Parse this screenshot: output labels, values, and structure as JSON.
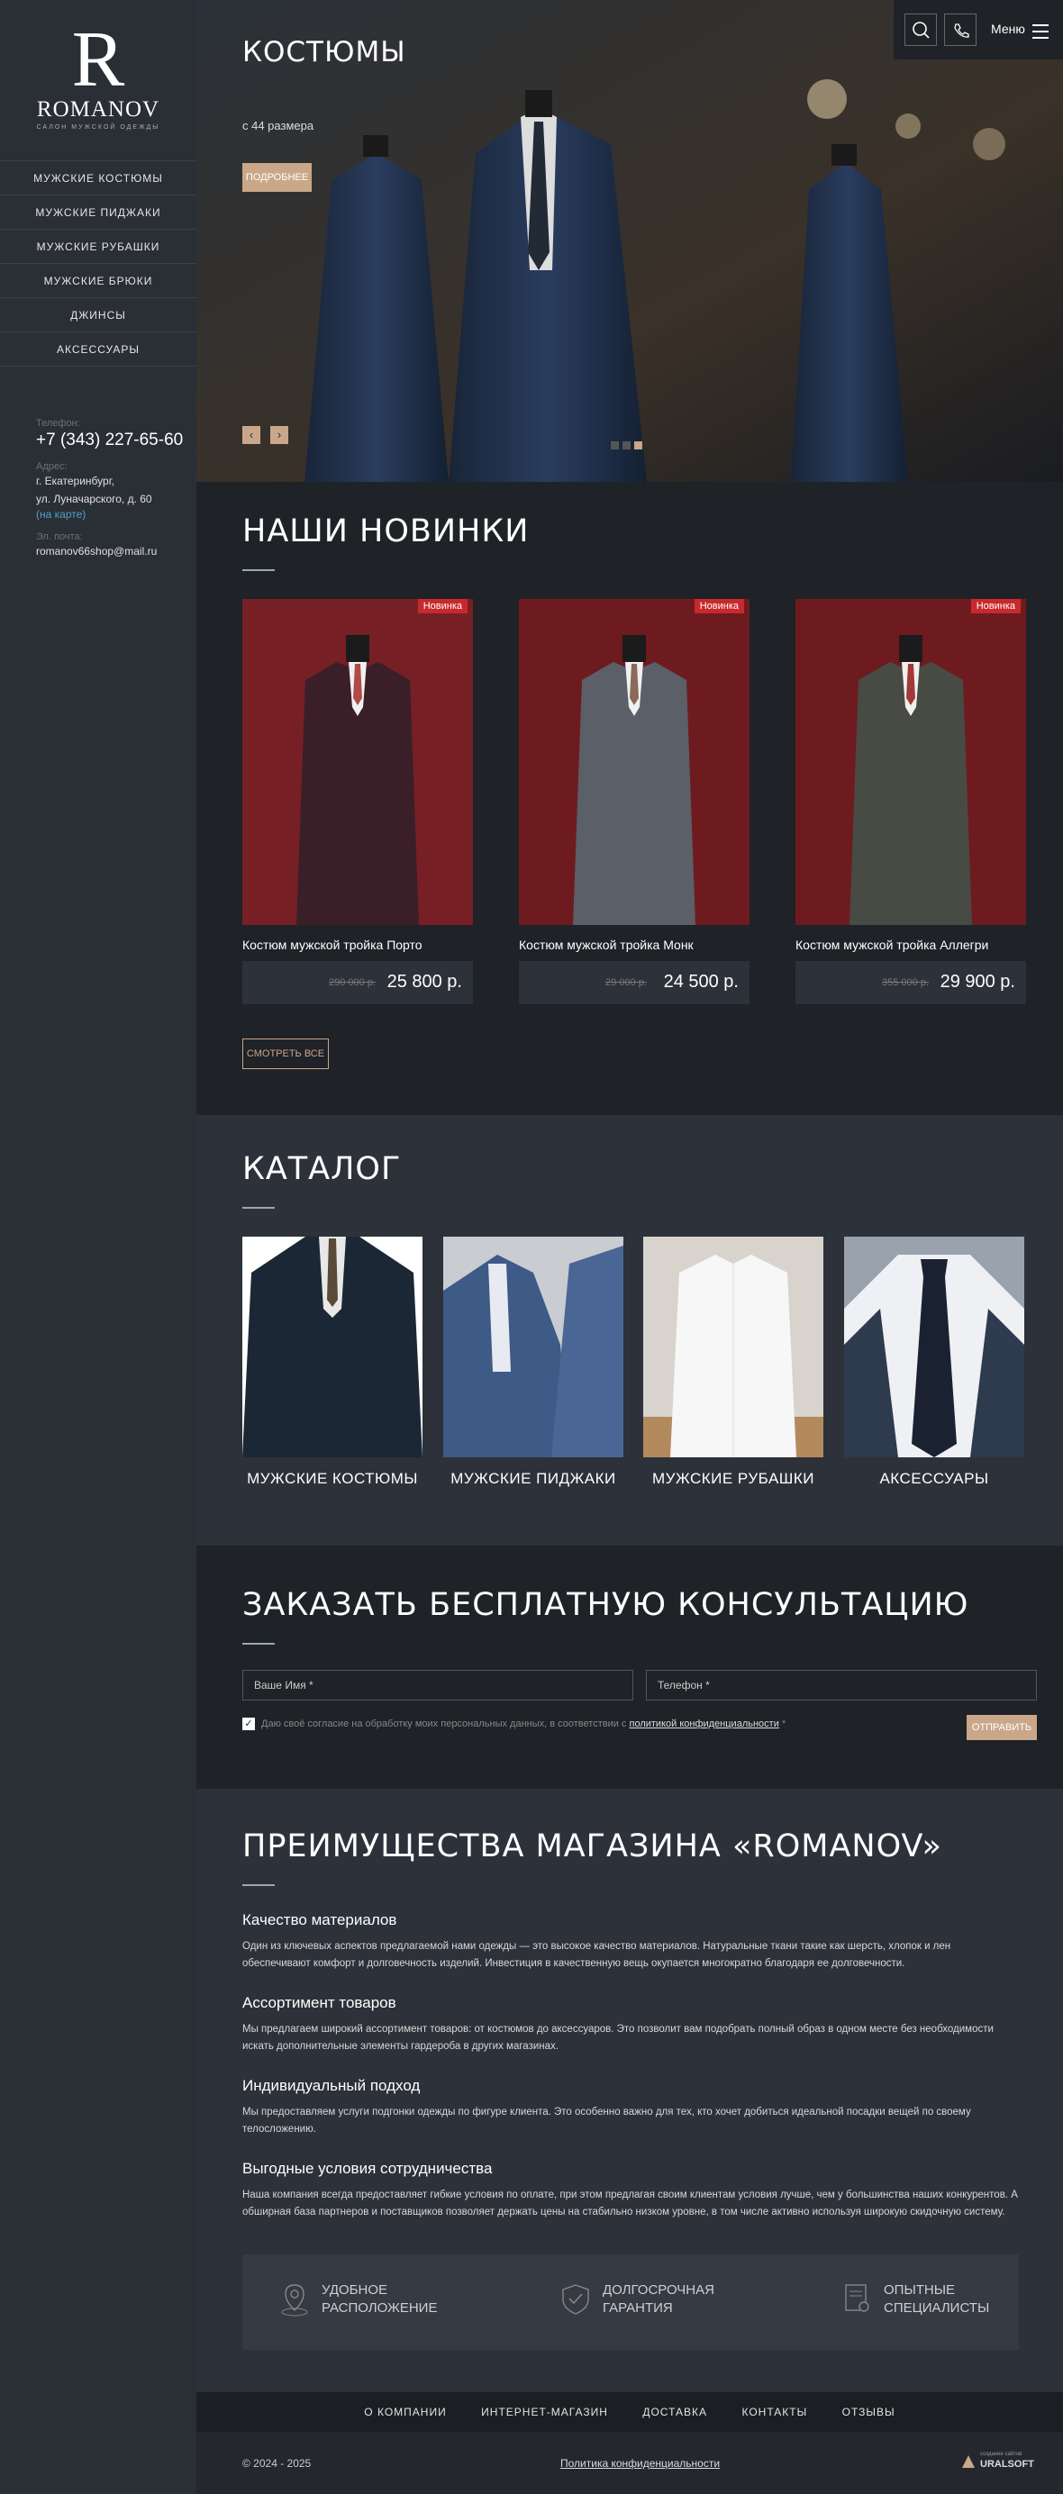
{
  "brand": {
    "letter": "R",
    "name": "ROMANOV",
    "tagline": "САЛОН МУЖСКОЙ ОДЕЖДЫ"
  },
  "sidebar": {
    "items": [
      {
        "label": "МУЖСКИЕ КОСТЮМЫ"
      },
      {
        "label": "МУЖСКИЕ ПИДЖАКИ"
      },
      {
        "label": "МУЖСКИЕ РУБАШКИ"
      },
      {
        "label": "МУЖСКИЕ БРЮКИ"
      },
      {
        "label": "ДЖИНСЫ"
      },
      {
        "label": "АКСЕССУАРЫ"
      }
    ],
    "phone_label": "Телефон:",
    "phone": "+7 (343) 227-65-60",
    "address_label": "Адрес:",
    "address1": "г. Екатеринбург,",
    "address2": "ул. Луначарского, д. 60",
    "map_link": "(на карте)",
    "email_label": "Эл. почта:",
    "email": "romanov66shop@mail.ru"
  },
  "header": {
    "menu_label": "Меню",
    "icons": [
      "search-icon",
      "phone-icon",
      "hamburger-icon"
    ]
  },
  "hero": {
    "title": "КОСТЮМЫ",
    "subtitle": "с 44 размера",
    "button": "ПОДРОБНЕЕ",
    "prev": "‹",
    "next": "›",
    "slide_count": 3,
    "active_slide": 3
  },
  "novelties": {
    "title": "НАШИ НОВИНКИ",
    "badge": "Новинка",
    "button": "СМОТРЕТЬ ВСЕ",
    "products": [
      {
        "name": "Костюм мужской тройка Порто",
        "old_price": "290 000 р.",
        "price": "25 800 р."
      },
      {
        "name": "Костюм мужской тройка Монк",
        "old_price": "29 000 р.",
        "price": "24 500 р."
      },
      {
        "name": "Костюм мужской тройка Аллегри",
        "old_price": "355 000 р.",
        "price": "29 900 р."
      }
    ]
  },
  "catalog": {
    "title": "КАТАЛОГ",
    "items": [
      {
        "label": "МУЖСКИЕ КОСТЮМЫ"
      },
      {
        "label": "МУЖСКИЕ ПИДЖАКИ"
      },
      {
        "label": "МУЖСКИЕ РУБАШКИ"
      },
      {
        "label": "АКСЕССУАРЫ"
      }
    ]
  },
  "consult": {
    "title": "ЗАКАЗАТЬ БЕСПЛАТНУЮ КОНСУЛЬТАЦИЮ",
    "name_placeholder": "Ваше Имя *",
    "phone_placeholder": "Телефон *",
    "agree_text": "Даю своё согласие на обработку моих персональных данных, в соответствии с ",
    "agree_link": "политикой конфиденциальности",
    "agree_star": " *",
    "submit": "ОТПРАВИТЬ"
  },
  "advantages": {
    "title": "ПРЕИМУЩЕСТВА МАГАЗИНА «ROMANOV»",
    "blocks": [
      {
        "h": "Качество материалов",
        "p": "Один из ключевых аспектов предлагаемой нами одежды — это высокое качество материалов. Натуральные ткани такие как шерсть, хлопок и лен обеспечивают комфорт и долговечность изделий. Инвестиция в качественную вещь окупается многократно благодаря ее долговечности."
      },
      {
        "h": "Ассортимент товаров",
        "p": "Мы предлагаем широкий ассортимент товаров: от костюмов до аксессуаров. Это позволит вам подобрать полный образ в одном месте без необходимости искать дополнительные элементы гардероба в других магазинах."
      },
      {
        "h": "Индивидуальный подход",
        "p": "Мы предоставляем услуги  подгонки одежды по фигуре клиента. Это особенно важно для тех, кто хочет добиться идеальной посадки вещей по своему телосложению."
      },
      {
        "h": "Выгодные условия сотрудничества",
        "p": "Наша компания всегда предоставляет гибкие условия по оплате, при этом предлагая своим клиентам условия лучше, чем у большинства наших конкурентов. А обширная база партнеров и поставщиков позволяет держать цены на стабильно низком уровне, в том числе активно используя широкую скидочную систему."
      }
    ],
    "features": [
      {
        "l1": "УДОБНОЕ",
        "l2": "РАСПОЛОЖЕНИЕ",
        "icon": "location-icon"
      },
      {
        "l1": "ДОЛГОСРОЧНАЯ",
        "l2": "ГАРАНТИЯ",
        "icon": "shield-icon"
      },
      {
        "l1": "ОПЫТНЫЕ",
        "l2": "СПЕЦИАЛИСТЫ",
        "icon": "certificate-icon"
      }
    ]
  },
  "footer": {
    "nav": [
      "О КОМПАНИИ",
      "ИНТЕРНЕТ-МАГАЗИН",
      "ДОСТАВКА",
      "КОНТАКТЫ",
      "ОТЗЫВЫ"
    ],
    "copyright": "© 2024 - 2025",
    "policy": "Политика конфиденциальности",
    "dev_small": "создание сайтов",
    "dev_name": "URALSOFT"
  }
}
